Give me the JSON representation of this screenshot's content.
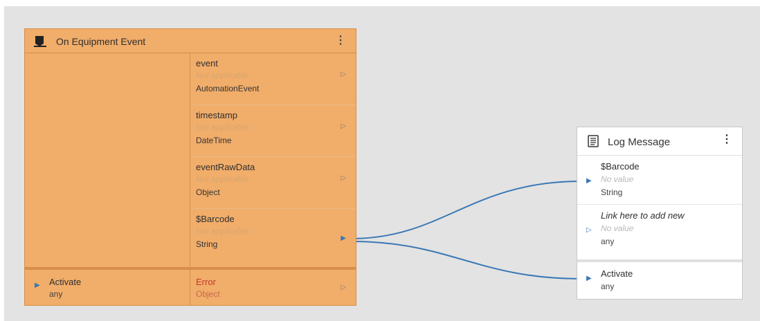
{
  "colors": {
    "node_orange": "#f1ad6a",
    "link_blue": "#3a78b5",
    "canvas": "#e3e3e3",
    "error_red": "#c0392b"
  },
  "equipment_node": {
    "title": "On Equipment Event",
    "icon": "flag-icon",
    "menu": "⋮",
    "outputs": [
      {
        "name": "event",
        "value": "Not applicable",
        "type": "AutomationEvent",
        "arrow": "▷",
        "linked": false
      },
      {
        "name": "timestamp",
        "value": "Not applicable",
        "type": "DateTime",
        "arrow": "▷",
        "linked": false
      },
      {
        "name": "eventRawData",
        "value": "Not applicable",
        "type": "Object",
        "arrow": "▷",
        "linked": false
      },
      {
        "name": "$Barcode",
        "value": "Not applicable",
        "type": "String",
        "arrow": "▶",
        "linked": true
      }
    ],
    "activate": {
      "name": "Activate",
      "type": "any",
      "arrow": "▶"
    },
    "error": {
      "name": "Error",
      "type": "Object",
      "arrow": "▷"
    }
  },
  "log_node": {
    "title": "Log Message",
    "icon": "document-icon",
    "menu": "⋮",
    "inputs": [
      {
        "name": "$Barcode",
        "value": "No value",
        "type": "String",
        "arrow": "▶"
      },
      {
        "name": "Link here to add new",
        "value": "No value",
        "type": "any",
        "arrow": "▷"
      }
    ],
    "activate": {
      "name": "Activate",
      "type": "any",
      "arrow": "▶"
    }
  }
}
